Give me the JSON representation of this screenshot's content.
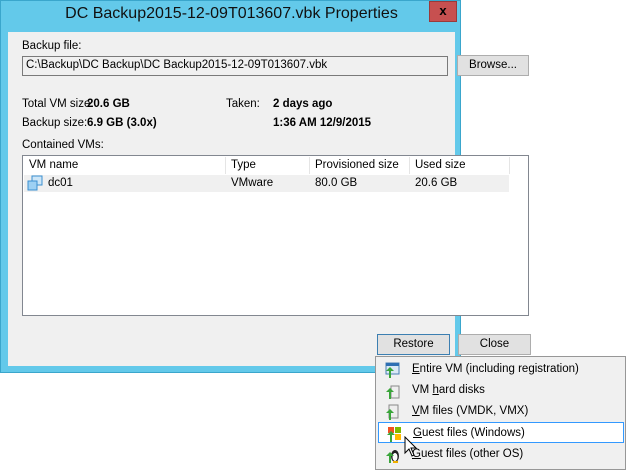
{
  "window": {
    "title": "DC Backup2015-12-09T013607.vbk Properties",
    "close_label": "x"
  },
  "backup_file": {
    "label": "Backup file:",
    "value": "C:\\Backup\\DC Backup\\DC Backup2015-12-09T013607.vbk",
    "browse_label": "Browse..."
  },
  "info": {
    "total_vm_size_label": "Total VM size:",
    "total_vm_size": "20.6 GB",
    "backup_size_label": "Backup size:",
    "backup_size": "6.9 GB (3.0x)",
    "taken_label": "Taken:",
    "taken_ago": "2 days ago",
    "taken_time": "1:36 AM 12/9/2015"
  },
  "vms": {
    "label": "Contained VMs:",
    "columns": [
      "VM name",
      "Type",
      "Provisioned size",
      "Used size"
    ],
    "rows": [
      {
        "name": "dc01",
        "type": "VMware",
        "provisioned": "80.0 GB",
        "used": "20.6 GB"
      }
    ]
  },
  "buttons": {
    "restore": "Restore",
    "close": "Close"
  },
  "menu": {
    "items": [
      {
        "accel": "E",
        "rest": "ntire VM (including registration)"
      },
      {
        "pre": "VM ",
        "accel": "h",
        "rest": "ard disks"
      },
      {
        "accel": "V",
        "rest": "M files (VMDK, VMX)"
      },
      {
        "accel": "G",
        "rest": "uest files (Windows)"
      },
      {
        "accel": "G",
        "rest": "uest files (other OS)"
      }
    ]
  }
}
